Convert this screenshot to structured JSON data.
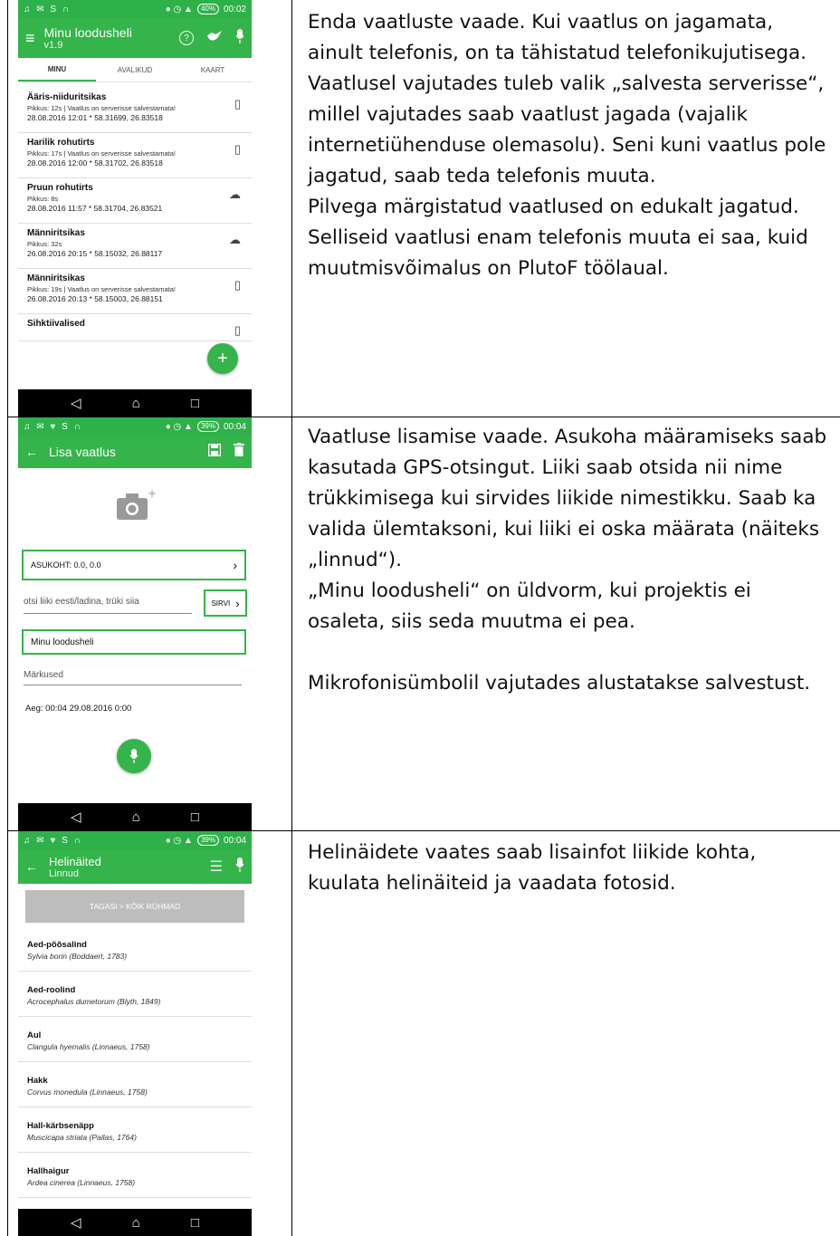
{
  "rows": [
    {
      "description": "Enda vaatluste vaade. Kui vaatlus on jagamata, ainult telefonis, on ta tähistatud telefonikujutisega. Vaatlusel vajutades tuleb valik „salvesta serverisse“, millel vajutades saab vaatlust jagada (vajalik internetiühenduse olemasolu). Seni kuni vaatlus pole jagatud, saab teda telefonis muuta.\nPilvega märgistatud vaatlused on edukalt jagatud. Selliseid vaatlusi enam telefonis muuta ei saa, kuid muutmisvõimalus on PlutoF töölaual."
    },
    {
      "description": "Vaatluse lisamise vaade. Asukoha määramiseks saab kasutada GPS-otsingut. Liiki saab otsida nii nime trükkimisega kui sirvides liikide nimestikku. Saab ka valida ülemtaksoni, kui liiki ei oska määrata (näiteks „linnud“).\n„Minu loodusheli“ on üldvorm, kui projektis ei osaleta, siis seda muutma ei pea.\n\nMikrofonisümbolil vajutades alustatakse salvestust."
    },
    {
      "description": "Helinäidete vaates saab lisainfot liikide kohta, kuulata helinäiteid ja vaadata fotosid."
    }
  ],
  "screen1": {
    "status_time": "00:02",
    "battery": "40%",
    "title": "Minu loodusheli",
    "version": "v1.9",
    "tabs": [
      "MINU",
      "AVALIKUD",
      "KAART"
    ],
    "observations": [
      {
        "name": "Ääris-niiduritsikas",
        "sub": "Pikkus: 12s | Vaatlus on serverisse salvestamata!",
        "date": "28.08.2016 12:01 * 58.31699, 26.83518",
        "icon": "phone-icon"
      },
      {
        "name": "Harilik rohutirts",
        "sub": "Pikkus: 17s | Vaatlus on serverisse salvestamata!",
        "date": "28.08.2016 12:00 * 58.31702, 26.83518",
        "icon": "phone-icon"
      },
      {
        "name": "Pruun rohutirts",
        "sub": "Pikkus: 8s",
        "date": "28.08.2016 11:57 * 58.31704, 26.83521",
        "icon": "cloud-check-icon"
      },
      {
        "name": "Männiritsikas",
        "sub": "Pikkus: 32s",
        "date": "26.08.2016 20:15 * 58.15032, 26.88117",
        "icon": "cloud-check-icon"
      },
      {
        "name": "Männiritsikas",
        "sub": "Pikkus: 19s | Vaatlus on serverisse salvestamata!",
        "date": "26.08.2016 20:13 * 58.15003, 26.88151",
        "icon": "phone-icon"
      },
      {
        "name": "Sihktiivalised",
        "sub": "",
        "date": "",
        "icon": "phone-icon"
      }
    ]
  },
  "screen2": {
    "status_time": "00:04",
    "battery": "39%",
    "title": "Lisa vaatlus",
    "location": "ASUKOHT: 0.0, 0.0",
    "species_placeholder": "otsi liiki eesti/ladina, trüki siia",
    "browse_label": "SIRVI",
    "project": "Minu loodusheli",
    "notes_placeholder": "Märkused",
    "time_label": "Aeg: 00:04 29.08.2016  0:00"
  },
  "screen3": {
    "status_time": "00:04",
    "battery": "39%",
    "title": "Helinäited",
    "subtitle": "Linnud",
    "back_label": "TAGASI > KÕIK RÜHMAD",
    "species": [
      {
        "name": "Aed-põõsalind",
        "latin": "Sylvia borin (Boddaert, 1783)"
      },
      {
        "name": "Aed-roolind",
        "latin": "Acrocephalus dumetorum (Blyth, 1849)"
      },
      {
        "name": "Aul",
        "latin": "Clangula hyemalis (Linnaeus, 1758)"
      },
      {
        "name": "Hakk",
        "latin": "Corvus monedula (Linnaeus, 1758)"
      },
      {
        "name": "Hall-kärbsenäpp",
        "latin": "Muscicapa striata (Pallas, 1764)"
      },
      {
        "name": "Hallhaigur",
        "latin": "Ardea cinerea (Linnaeus, 1758)"
      }
    ]
  },
  "colors": {
    "accent": "#34b44a",
    "status": "#2fb149",
    "navbar": "#000000"
  }
}
